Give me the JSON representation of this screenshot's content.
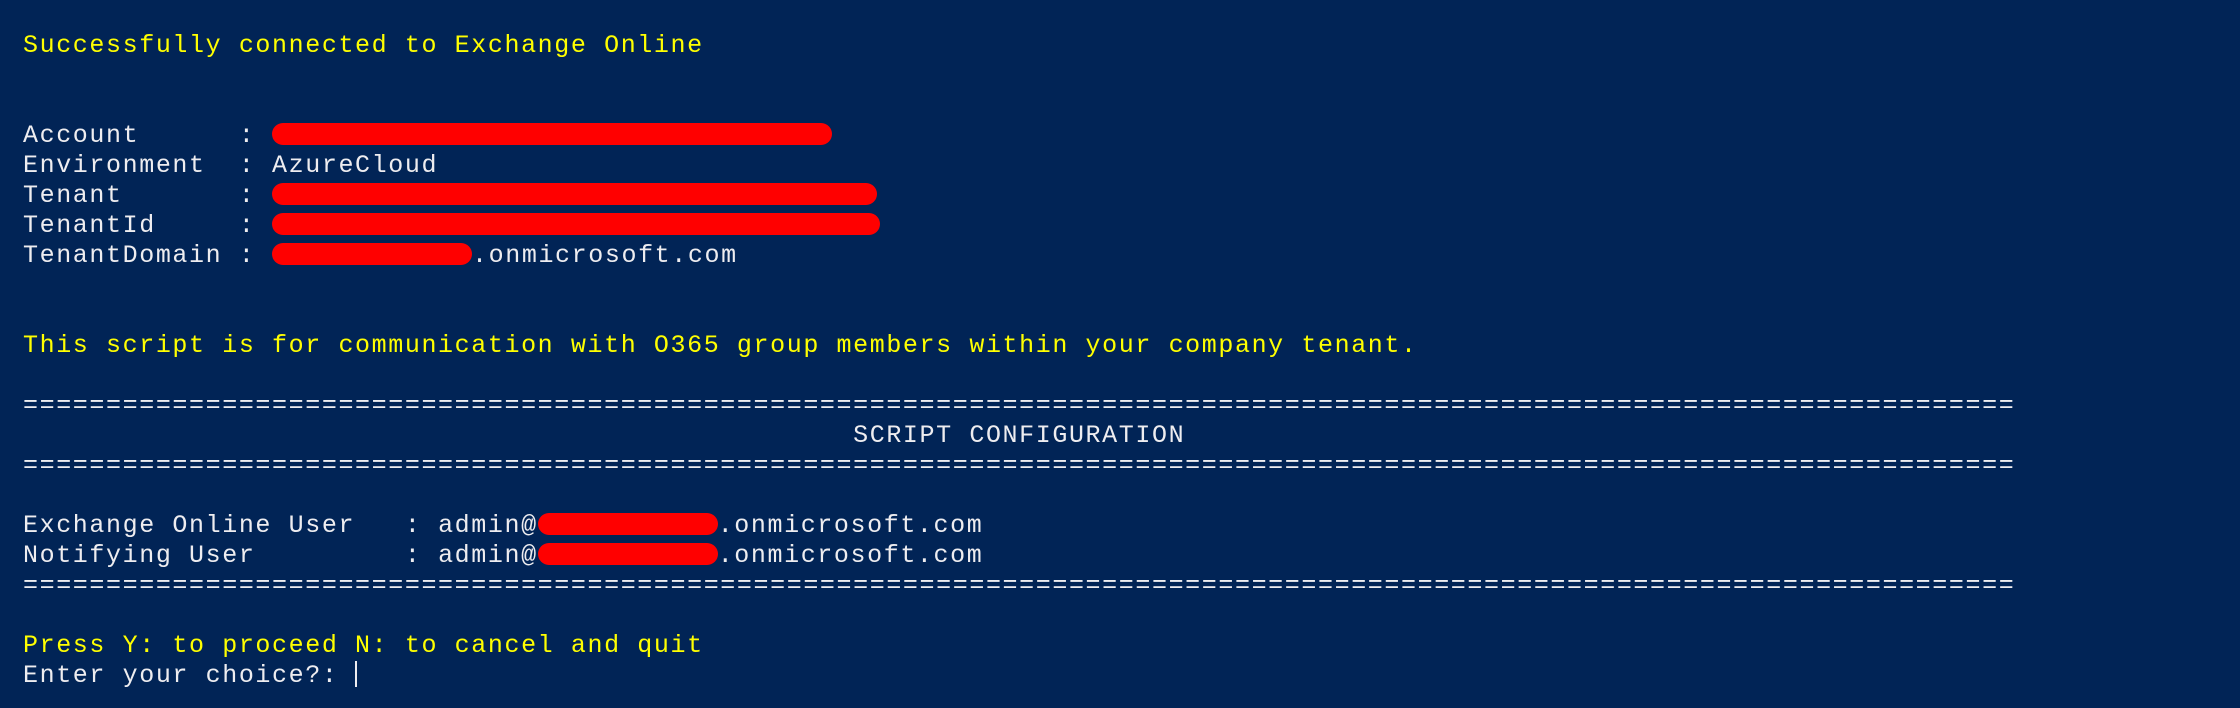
{
  "colors": {
    "background": "#012456",
    "text": "#eeedf0",
    "highlight": "#ffff00",
    "redaction": "#ff0000"
  },
  "connection_message": "Successfully connected to Exchange Online",
  "connection_info": [
    {
      "label": "Account      : ",
      "value": "",
      "redacted": true
    },
    {
      "label": "Environment  : ",
      "value": "AzureCloud",
      "redacted": false
    },
    {
      "label": "Tenant       : ",
      "value": "",
      "redacted": true
    },
    {
      "label": "TenantId     : ",
      "value": "",
      "redacted": true
    },
    {
      "label": "TenantDomain : ",
      "value": ".onmicrosoft.com",
      "redacted": true
    }
  ],
  "intro_message": "This script is for communication with O365 group members within your company tenant.",
  "separator": "========================================================================================================================",
  "config_title": "                                                  SCRIPT CONFIGURATION",
  "config": [
    {
      "label": "Exchange Online User   : ",
      "prefix": "admin@",
      "suffix": ".onmicrosoft.com"
    },
    {
      "label": "Notifying User         : ",
      "prefix": "admin@",
      "suffix": ".onmicrosoft.com"
    }
  ],
  "prompt": "Press Y: to proceed N: to cancel and quit",
  "input_label": "Enter your choice?: ",
  "input_value": ""
}
